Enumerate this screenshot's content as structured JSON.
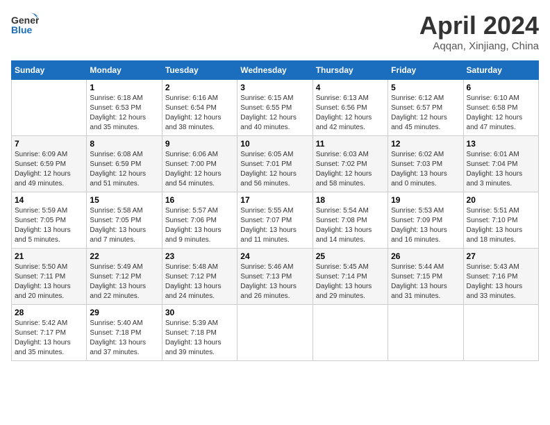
{
  "header": {
    "logo_general": "General",
    "logo_blue": "Blue",
    "month_title": "April 2024",
    "location": "Aqqan, Xinjiang, China"
  },
  "days_of_week": [
    "Sunday",
    "Monday",
    "Tuesday",
    "Wednesday",
    "Thursday",
    "Friday",
    "Saturday"
  ],
  "weeks": [
    [
      {
        "day": "",
        "info": ""
      },
      {
        "day": "1",
        "info": "Sunrise: 6:18 AM\nSunset: 6:53 PM\nDaylight: 12 hours\nand 35 minutes."
      },
      {
        "day": "2",
        "info": "Sunrise: 6:16 AM\nSunset: 6:54 PM\nDaylight: 12 hours\nand 38 minutes."
      },
      {
        "day": "3",
        "info": "Sunrise: 6:15 AM\nSunset: 6:55 PM\nDaylight: 12 hours\nand 40 minutes."
      },
      {
        "day": "4",
        "info": "Sunrise: 6:13 AM\nSunset: 6:56 PM\nDaylight: 12 hours\nand 42 minutes."
      },
      {
        "day": "5",
        "info": "Sunrise: 6:12 AM\nSunset: 6:57 PM\nDaylight: 12 hours\nand 45 minutes."
      },
      {
        "day": "6",
        "info": "Sunrise: 6:10 AM\nSunset: 6:58 PM\nDaylight: 12 hours\nand 47 minutes."
      }
    ],
    [
      {
        "day": "7",
        "info": "Sunrise: 6:09 AM\nSunset: 6:59 PM\nDaylight: 12 hours\nand 49 minutes."
      },
      {
        "day": "8",
        "info": "Sunrise: 6:08 AM\nSunset: 6:59 PM\nDaylight: 12 hours\nand 51 minutes."
      },
      {
        "day": "9",
        "info": "Sunrise: 6:06 AM\nSunset: 7:00 PM\nDaylight: 12 hours\nand 54 minutes."
      },
      {
        "day": "10",
        "info": "Sunrise: 6:05 AM\nSunset: 7:01 PM\nDaylight: 12 hours\nand 56 minutes."
      },
      {
        "day": "11",
        "info": "Sunrise: 6:03 AM\nSunset: 7:02 PM\nDaylight: 12 hours\nand 58 minutes."
      },
      {
        "day": "12",
        "info": "Sunrise: 6:02 AM\nSunset: 7:03 PM\nDaylight: 13 hours\nand 0 minutes."
      },
      {
        "day": "13",
        "info": "Sunrise: 6:01 AM\nSunset: 7:04 PM\nDaylight: 13 hours\nand 3 minutes."
      }
    ],
    [
      {
        "day": "14",
        "info": "Sunrise: 5:59 AM\nSunset: 7:05 PM\nDaylight: 13 hours\nand 5 minutes."
      },
      {
        "day": "15",
        "info": "Sunrise: 5:58 AM\nSunset: 7:05 PM\nDaylight: 13 hours\nand 7 minutes."
      },
      {
        "day": "16",
        "info": "Sunrise: 5:57 AM\nSunset: 7:06 PM\nDaylight: 13 hours\nand 9 minutes."
      },
      {
        "day": "17",
        "info": "Sunrise: 5:55 AM\nSunset: 7:07 PM\nDaylight: 13 hours\nand 11 minutes."
      },
      {
        "day": "18",
        "info": "Sunrise: 5:54 AM\nSunset: 7:08 PM\nDaylight: 13 hours\nand 14 minutes."
      },
      {
        "day": "19",
        "info": "Sunrise: 5:53 AM\nSunset: 7:09 PM\nDaylight: 13 hours\nand 16 minutes."
      },
      {
        "day": "20",
        "info": "Sunrise: 5:51 AM\nSunset: 7:10 PM\nDaylight: 13 hours\nand 18 minutes."
      }
    ],
    [
      {
        "day": "21",
        "info": "Sunrise: 5:50 AM\nSunset: 7:11 PM\nDaylight: 13 hours\nand 20 minutes."
      },
      {
        "day": "22",
        "info": "Sunrise: 5:49 AM\nSunset: 7:12 PM\nDaylight: 13 hours\nand 22 minutes."
      },
      {
        "day": "23",
        "info": "Sunrise: 5:48 AM\nSunset: 7:12 PM\nDaylight: 13 hours\nand 24 minutes."
      },
      {
        "day": "24",
        "info": "Sunrise: 5:46 AM\nSunset: 7:13 PM\nDaylight: 13 hours\nand 26 minutes."
      },
      {
        "day": "25",
        "info": "Sunrise: 5:45 AM\nSunset: 7:14 PM\nDaylight: 13 hours\nand 29 minutes."
      },
      {
        "day": "26",
        "info": "Sunrise: 5:44 AM\nSunset: 7:15 PM\nDaylight: 13 hours\nand 31 minutes."
      },
      {
        "day": "27",
        "info": "Sunrise: 5:43 AM\nSunset: 7:16 PM\nDaylight: 13 hours\nand 33 minutes."
      }
    ],
    [
      {
        "day": "28",
        "info": "Sunrise: 5:42 AM\nSunset: 7:17 PM\nDaylight: 13 hours\nand 35 minutes."
      },
      {
        "day": "29",
        "info": "Sunrise: 5:40 AM\nSunset: 7:18 PM\nDaylight: 13 hours\nand 37 minutes."
      },
      {
        "day": "30",
        "info": "Sunrise: 5:39 AM\nSunset: 7:18 PM\nDaylight: 13 hours\nand 39 minutes."
      },
      {
        "day": "",
        "info": ""
      },
      {
        "day": "",
        "info": ""
      },
      {
        "day": "",
        "info": ""
      },
      {
        "day": "",
        "info": ""
      }
    ]
  ]
}
